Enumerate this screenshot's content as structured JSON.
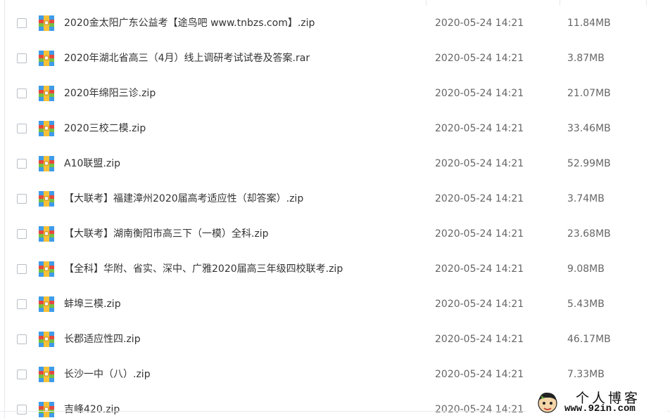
{
  "file_list": {
    "rows": [
      {
        "name": "2020金太阳广东公益考【途鸟吧 www.tnbzs.com】.zip",
        "date": "2020-05-24 14:21",
        "size": "11.84MB",
        "icon": "archive-icon"
      },
      {
        "name": "2020年湖北省高三（4月）线上调研考试试卷及答案.rar",
        "date": "2020-05-24 14:21",
        "size": "3.87MB",
        "icon": "archive-icon"
      },
      {
        "name": "2020年绵阳三诊.zip",
        "date": "2020-05-24 14:21",
        "size": "21.07MB",
        "icon": "archive-icon"
      },
      {
        "name": "2020三校二模.zip",
        "date": "2020-05-24 14:21",
        "size": "33.46MB",
        "icon": "archive-icon"
      },
      {
        "name": "A10联盟.zip",
        "date": "2020-05-24 14:21",
        "size": "52.99MB",
        "icon": "archive-icon"
      },
      {
        "name": "【大联考】福建漳州2020届高考适应性（却答案）.zip",
        "date": "2020-05-24 14:21",
        "size": "3.74MB",
        "icon": "archive-icon"
      },
      {
        "name": "【大联考】湖南衡阳市高三下（一模）全科.zip",
        "date": "2020-05-24 14:21",
        "size": "23.68MB",
        "icon": "archive-icon"
      },
      {
        "name": "【全科】华附、省实、深中、广雅2020届高三年级四校联考.zip",
        "date": "2020-05-24 14:21",
        "size": "9.08MB",
        "icon": "archive-icon"
      },
      {
        "name": "蚌埠三模.zip",
        "date": "2020-05-24 14:21",
        "size": "5.43MB",
        "icon": "archive-icon"
      },
      {
        "name": "长郡适应性四.zip",
        "date": "2020-05-24 14:21",
        "size": "46.17MB",
        "icon": "archive-icon"
      },
      {
        "name": "长沙一中（八）.zip",
        "date": "2020-05-24 14:21",
        "size": "7.33MB",
        "icon": "archive-icon"
      },
      {
        "name": "吉峰420.zip",
        "date": "2020-05-24 14:21",
        "size": "",
        "icon": "archive-icon"
      }
    ]
  },
  "watermark": {
    "title": "个人博客",
    "url": "www.92in.com",
    "icon": "cartoon-face-icon"
  },
  "colors": {
    "text": "#333333",
    "meta_text": "#666666",
    "divider": "#e6e9ee",
    "icon_blue": "#3f9be8",
    "icon_red": "#e8483c",
    "icon_green": "#76c043",
    "icon_yellow": "#f7c137"
  }
}
